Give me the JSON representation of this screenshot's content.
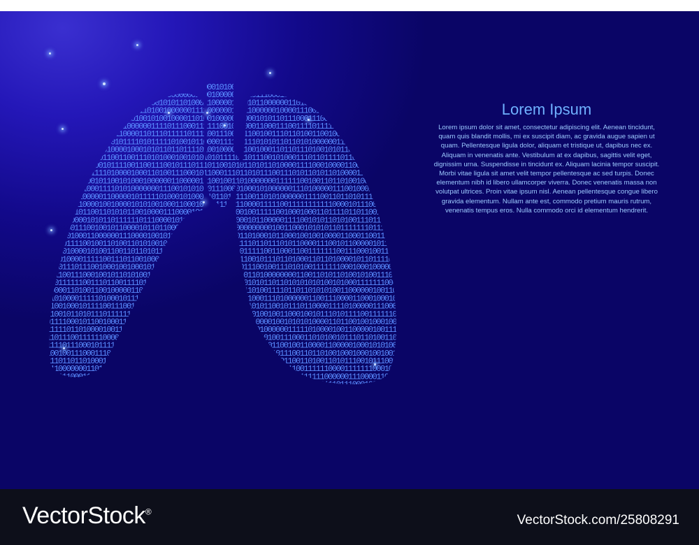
{
  "heading": "Lorem Ipsum",
  "body_text": "Lorem ipsum dolor sit amet, consectetur adipiscing elit. Aenean tincidunt, quam quis blandit mollis, mi ex suscipit diam, ac gravida augue sapien ut quam. Pellentesque ligula dolor, aliquam et tristique ut, dapibus nec ex. Aliquam in venenatis ante. Vestibulum at ex dapibus, sagittis velit eget, dignissim urna. Suspendisse in tincidunt ex. Aliquam lacinia tempor suscipit. Morbi vitae ligula sit amet velit tempor pellentesque ac sed turpis. Donec elementum nibh id libero ullamcorper viverra. Donec venenatis massa non volutpat ultrices. Proin vitae ipsum nisl. Aenean pellentesque congue libero gravida elementum. Nullam ante est, commodo pretium mauris rutrum, venenatis tempus eros. Nulla commodo orci id elementum hendrerit.",
  "footer": {
    "logo": "VectorStock",
    "logo_mark": "®",
    "image_id": "VectorStock.com/25808291"
  },
  "colors": {
    "background_dark": "#0a0566",
    "background_glow": "#3a2fd0",
    "digits": "#5a8dff",
    "heading": "#6fb1ff",
    "footer_bg": "#0d0f1a"
  }
}
